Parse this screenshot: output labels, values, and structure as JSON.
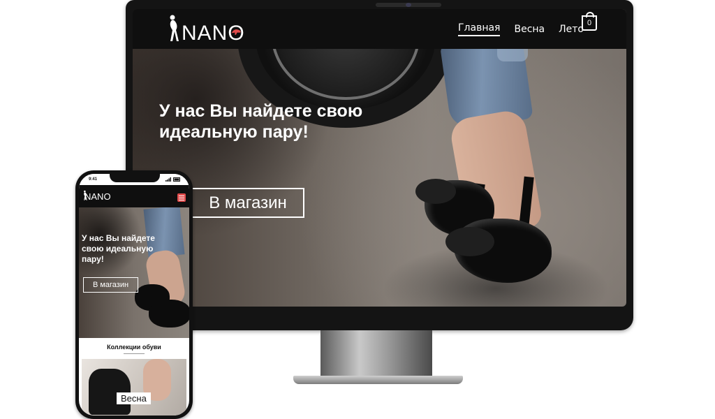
{
  "desktop": {
    "logo": "NANO",
    "nav": [
      {
        "label": "Главная",
        "active": true
      },
      {
        "label": "Весна",
        "active": false
      },
      {
        "label": "Лето",
        "active": false
      }
    ],
    "cart_count": "0",
    "hero_title": "У нас Вы найдете свою идеальную пару!",
    "cta_label": "В магазин"
  },
  "mobile": {
    "status_time": "9:41",
    "logo": "NANO",
    "hero_title": "У нас Вы найдете свою идеальную пару!",
    "cta_label": "В магазин",
    "section_title": "Коллекции обуви",
    "card_label": "Весна",
    "menu_color": "#e24c4c"
  }
}
